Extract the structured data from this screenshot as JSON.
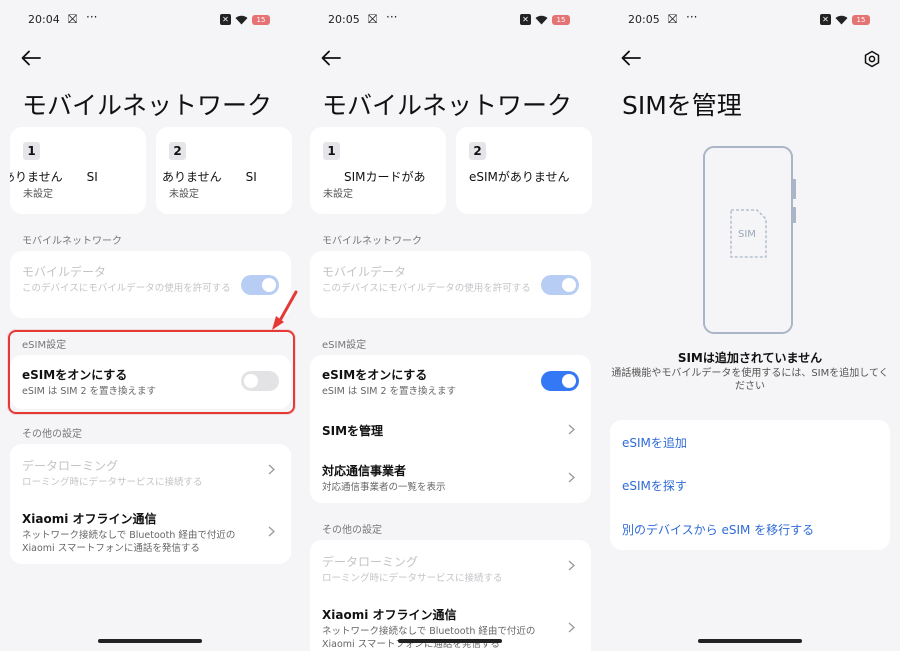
{
  "panel1": {
    "time": "20:04",
    "battery": "15",
    "title": "モバイルネットワーク",
    "sim1": {
      "num": "1",
      "name": "ありません　　SI",
      "status": "未設定"
    },
    "sim2": {
      "num": "2",
      "name": "ありません　　SI",
      "status": "未設定"
    },
    "section_mobile": "モバイルネットワーク",
    "mobile_data": {
      "title": "モバイルデータ",
      "desc": "このデバイスにモバイルデータの使用を許可する"
    },
    "section_esim": "eSIM設定",
    "esim_toggle": {
      "title": "eSIMをオンにする",
      "desc": "eSIM は SIM 2 を置き換えます"
    },
    "section_other": "その他の設定",
    "roaming": {
      "title": "データローミング",
      "desc": "ローミング時にデータサービスに接続する"
    },
    "offline": {
      "title": "Xiaomi オフライン通信",
      "desc": "ネットワーク接続なしで Bluetooth 経由で付近の Xiaomi スマートフォンに通話を発信する"
    }
  },
  "panel2": {
    "time": "20:05",
    "battery": "15",
    "title": "モバイルネットワーク",
    "sim1": {
      "num": "1",
      "name": "SIMカードがあ",
      "status": "未設定"
    },
    "sim2": {
      "num": "2",
      "name": "eSIMがありません"
    },
    "section_mobile": "モバイルネットワーク",
    "mobile_data": {
      "title": "モバイルデータ",
      "desc": "このデバイスにモバイルデータの使用を許可する"
    },
    "section_esim": "eSIM設定",
    "esim_toggle": {
      "title": "eSIMをオンにする",
      "desc": "eSIM は SIM 2 を置き換えます"
    },
    "manage_sim": "SIMを管理",
    "carriers": {
      "title": "対応通信事業者",
      "desc": "対応通信事業者の一覧を表示"
    },
    "section_other": "その他の設定",
    "roaming": {
      "title": "データローミング",
      "desc": "ローミング時にデータサービスに接続する"
    },
    "offline": {
      "title": "Xiaomi オフライン通信",
      "desc": "ネットワーク接続なしで Bluetooth 経由で付近の Xiaomi スマートフォンに通話を発信する"
    }
  },
  "panel3": {
    "time": "20:05",
    "battery": "15",
    "title": "SIMを管理",
    "sim_label": "SIM",
    "no_sim_title": "SIMは追加されていません",
    "no_sim_desc": "通話機能やモバイルデータを使用するには、SIMを追加してください",
    "links": [
      "eSIMを追加",
      "eSIMを探す",
      "別のデバイスから eSIM を移行する"
    ]
  },
  "colors": {
    "accent": "#3478f6",
    "highlight": "#e53935",
    "link": "#2f6bd6"
  }
}
